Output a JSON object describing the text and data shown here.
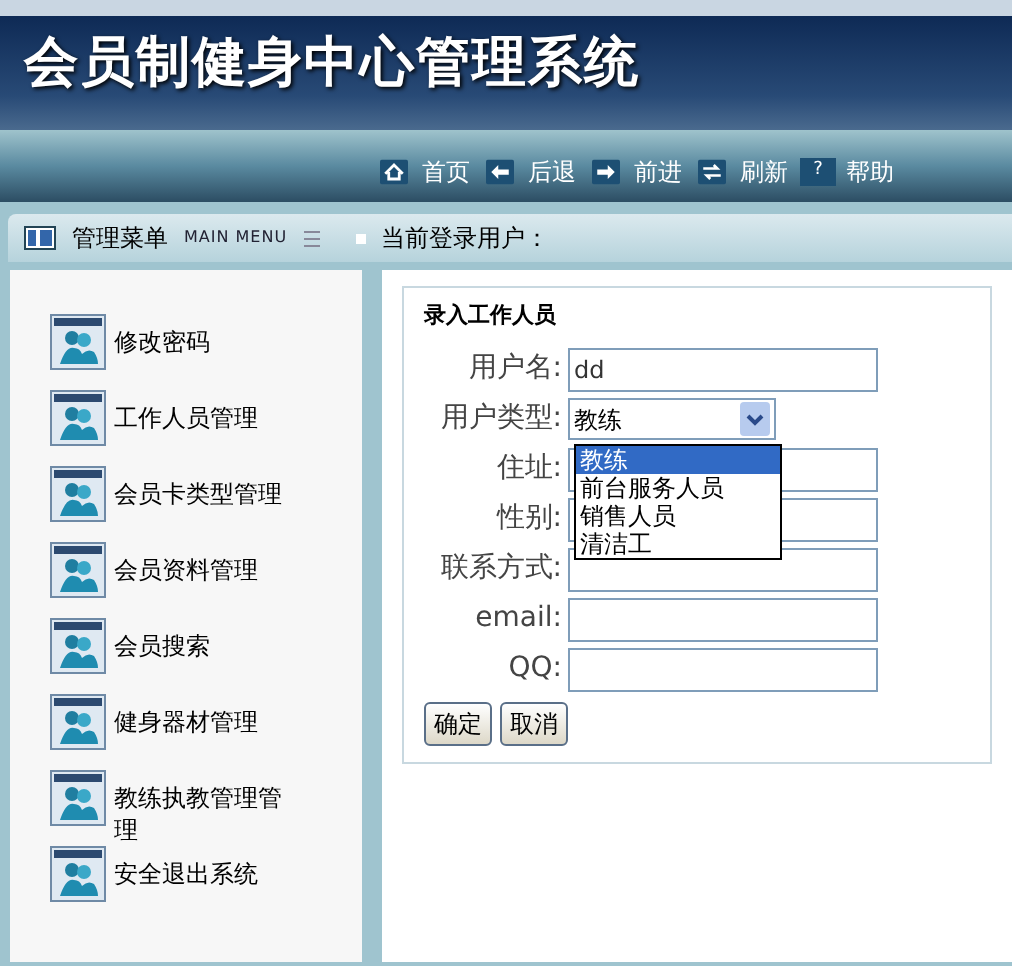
{
  "header": {
    "title": "会员制健身中心管理系统"
  },
  "nav": [
    {
      "label": "首页"
    },
    {
      "label": "后退"
    },
    {
      "label": "前进"
    },
    {
      "label": "刷新"
    },
    {
      "icon_glyph": "?",
      "label": "帮助"
    }
  ],
  "menu_bar": {
    "title": "管理菜单",
    "subtitle": "MAIN MENU",
    "user_label": "当前登录用户："
  },
  "sidebar": {
    "items": [
      {
        "label": "修改密码"
      },
      {
        "label": "工作人员管理"
      },
      {
        "label": "会员卡类型管理"
      },
      {
        "label": "会员资料管理"
      },
      {
        "label": "会员搜索"
      },
      {
        "label": "健身器材管理"
      },
      {
        "label": "教练执教管理管理"
      },
      {
        "label": "安全退出系统"
      }
    ]
  },
  "form": {
    "title": "录入工作人员",
    "fields": [
      {
        "kind": "text",
        "label": "用户名:",
        "value": "dd"
      },
      {
        "kind": "select",
        "label": "用户类型:",
        "value": "教练",
        "expanded": true,
        "options": [
          {
            "label": "教练",
            "selected": true
          },
          {
            "label": "前台服务人员",
            "selected": false
          },
          {
            "label": "销售人员",
            "selected": false
          },
          {
            "label": "清洁工",
            "selected": false
          }
        ]
      },
      {
        "kind": "text",
        "label": "住址:"
      },
      {
        "kind": "text",
        "label": "性别:"
      },
      {
        "kind": "text",
        "label": "联系方式:"
      },
      {
        "kind": "text",
        "label": "email:"
      },
      {
        "kind": "text",
        "label": "QQ:"
      }
    ],
    "buttons": [
      "确定",
      "取消"
    ]
  }
}
